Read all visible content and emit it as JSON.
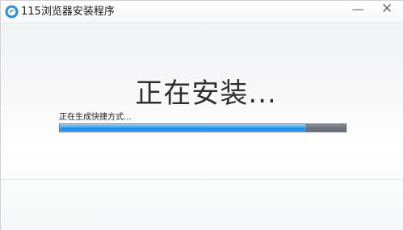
{
  "window": {
    "title": "115浏览器安装程序",
    "icon": "115-browser-logo-icon",
    "controls": {
      "minimize": "—",
      "close": "✕"
    }
  },
  "main": {
    "heading": "正在安装...",
    "status_text": "正在生成快捷方式...",
    "progress_fraction": 0.86
  },
  "colors": {
    "progress_fill": "#2a98ea",
    "progress_track": "#6d737a"
  }
}
